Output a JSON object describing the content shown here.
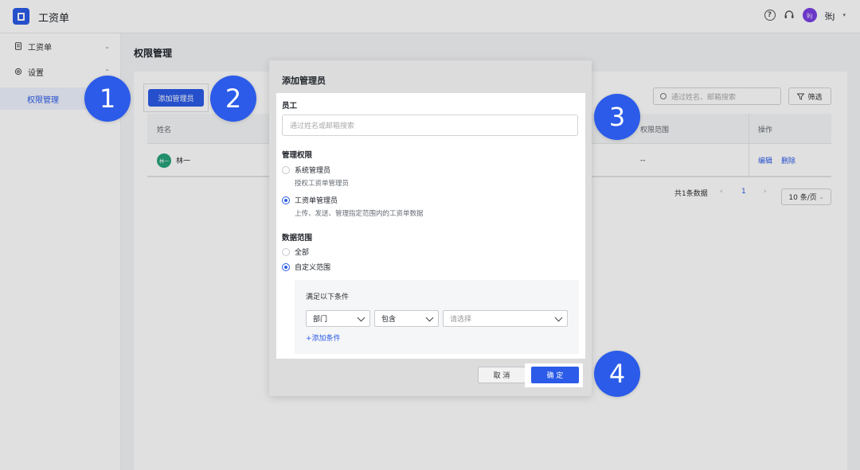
{
  "app": {
    "title": "工资单"
  },
  "header": {
    "user_name": "张J",
    "user_initials": "张J"
  },
  "sidebar": {
    "items": [
      {
        "label": "工资单"
      },
      {
        "label": "设置"
      }
    ],
    "sub_item": "权限管理"
  },
  "main": {
    "page_title": "权限管理",
    "add_button": "添加管理员",
    "search_placeholder": "通过姓名、邮箱搜索",
    "filter_button": "筛选",
    "table": {
      "headers": [
        "姓名",
        "权限范围",
        "操作"
      ],
      "rows": [
        {
          "avatar": "林一",
          "name": "林一",
          "scope": "--",
          "edit": "编辑",
          "delete": "删除"
        }
      ]
    },
    "pagination": {
      "total": "共1条数据",
      "current": "1",
      "page_size": "10 条/页"
    }
  },
  "dialog": {
    "title": "添加管理员",
    "employee_label": "员工",
    "employee_placeholder": "通过姓名或邮箱搜索",
    "permission_label": "管理权限",
    "permission_options": [
      {
        "label": "系统管理员",
        "desc": "授权工资单管理员",
        "selected": false
      },
      {
        "label": "工资单管理员",
        "desc": "上传、发送、管理指定范围内的工资单数据",
        "selected": true
      }
    ],
    "scope_label": "数据范围",
    "scope_options": [
      {
        "label": "全部",
        "selected": false
      },
      {
        "label": "自定义范围",
        "selected": true
      }
    ],
    "condition_title": "满足以下条件",
    "condition_field": "部门",
    "condition_operator": "包含",
    "condition_value_placeholder": "请选择",
    "add_condition": "+添加条件",
    "cancel": "取 消",
    "confirm": "确 定"
  },
  "steps": [
    "1",
    "2",
    "3",
    "4"
  ],
  "colors": {
    "accent": "#2b5be8",
    "avatar_user": "#7a3fe4",
    "avatar_row": "#28a27b"
  }
}
